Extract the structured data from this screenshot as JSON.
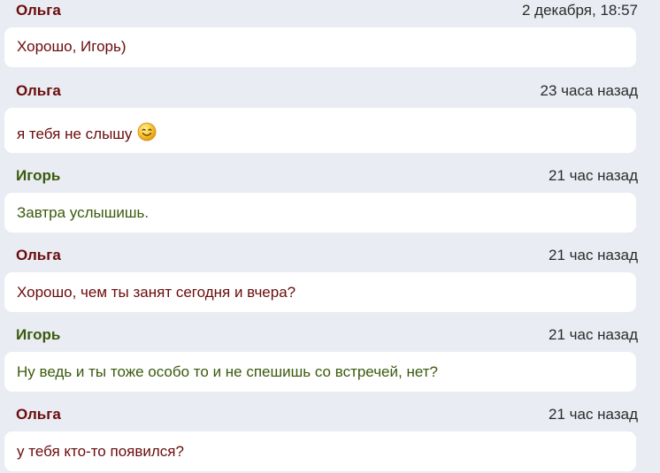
{
  "messages": [
    {
      "author": "Ольга",
      "time": "2 декабря, 18:57",
      "text": "Хорошо, Игорь)"
    },
    {
      "author": "Ольга",
      "time": "23 часа назад",
      "text": "я тебя не слышу",
      "emoji": "smiley-face-icon"
    },
    {
      "author": "Игорь",
      "time": "21 час назад",
      "text": "Завтра услышишь."
    },
    {
      "author": "Ольга",
      "time": "21 час назад",
      "text": "Хорошо, чем ты занят сегодня и вчера?"
    },
    {
      "author": "Игорь",
      "time": "21 час назад",
      "text": "Ну ведь и ты тоже особо то и не спешишь со встречей, нет?"
    },
    {
      "author": "Ольга",
      "time": "21 час назад",
      "text": "у тебя кто-то появился?"
    }
  ],
  "colors": {
    "background": "#e9ecf2",
    "bubble": "#ffffff",
    "olga": "#6b0b0b",
    "igor": "#3a5a0c"
  }
}
